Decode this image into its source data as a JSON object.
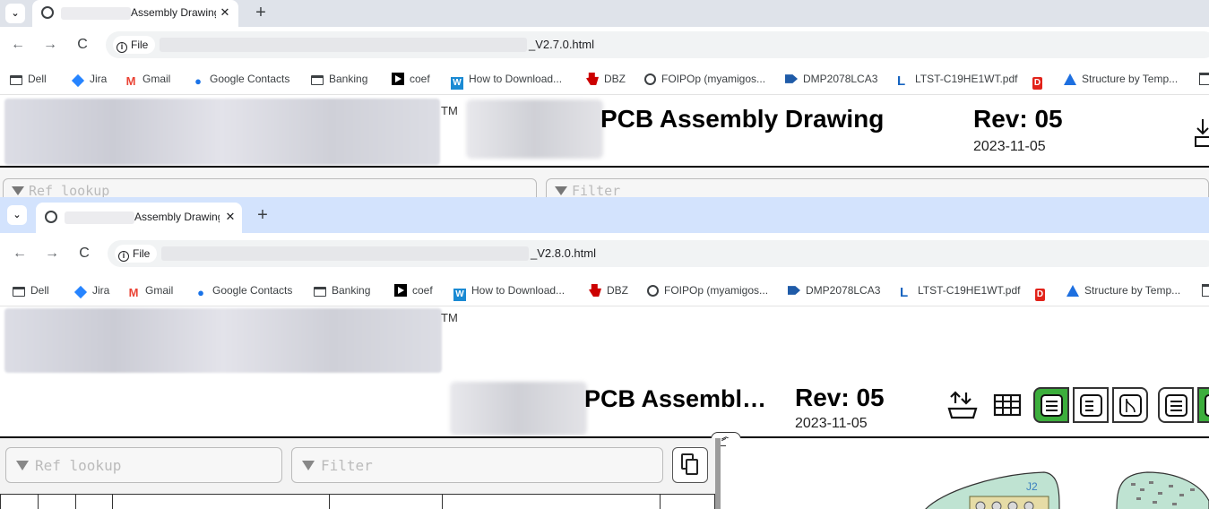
{
  "window1": {
    "tab_title": "Assembly Drawing",
    "new_tab_label": "+",
    "close_label": "✕",
    "address_info": "File",
    "address_file": "_V2.7.0.html",
    "page": {
      "tm": "TM",
      "title": "PCB Assembly Drawing",
      "rev": "Rev: 05",
      "date": "2023-11-05",
      "ref_lookup_placeholder": "Ref lookup",
      "filter_placeholder": "Filter"
    }
  },
  "window2": {
    "tab_title": "Assembly Drawing",
    "new_tab_label": "+",
    "close_label": "✕",
    "address_info": "File",
    "address_file": "_V2.8.0.html",
    "page": {
      "tm": "TM",
      "title": "PCB Assembl…",
      "rev": "Rev: 05",
      "date": "2023-11-05",
      "ref_lookup_placeholder": "Ref lookup",
      "filter_placeholder": "Filter",
      "board_label": "J2"
    }
  },
  "nav": {
    "back": "←",
    "forward": "→",
    "reload": "C",
    "menu": "⌄"
  },
  "bookmarks": [
    {
      "label": "Dell",
      "icon": "folder-icon"
    },
    {
      "label": "Jira",
      "icon": "jira-icon"
    },
    {
      "label": "Gmail",
      "icon": "gmail-icon"
    },
    {
      "label": "Google Contacts",
      "icon": "contacts-icon"
    },
    {
      "label": "Banking",
      "icon": "folder-icon"
    },
    {
      "label": "coef",
      "icon": "coef-icon"
    },
    {
      "label": "How to Download...",
      "icon": "w-icon"
    },
    {
      "label": "DBZ",
      "icon": "ti-icon"
    },
    {
      "label": "FOIPOp (myamigos...",
      "icon": "globe-icon"
    },
    {
      "label": "DMP2078LCA3",
      "icon": "diodes-icon"
    },
    {
      "label": "LTST-C19HE1WT.pdf",
      "icon": "liteon-icon"
    },
    {
      "label": "",
      "icon": "digikey-icon"
    },
    {
      "label": "Structure by Temp...",
      "icon": "structure-icon"
    }
  ],
  "colors": {
    "tabstrip_inactive": "#dfe3ea",
    "tabstrip_active": "#d3e3fd",
    "toggle_active": "#3cae3c"
  }
}
